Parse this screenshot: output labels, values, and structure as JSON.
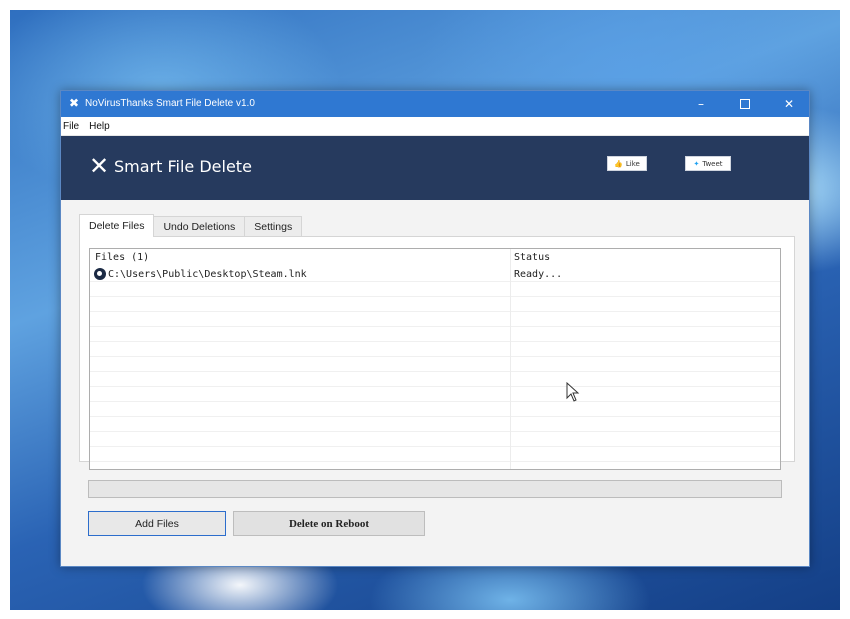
{
  "window": {
    "title": "NoVirusThanks Smart File Delete v1.0",
    "min_glyph": "–",
    "close_glyph": "✕"
  },
  "menu": {
    "items": [
      "File",
      "Help"
    ]
  },
  "banner": {
    "logo_glyph": "✕",
    "title": "Smart File Delete",
    "like_label": "Like",
    "tweet_label": "Tweet"
  },
  "tabs": [
    {
      "label": "Delete Files",
      "active": true
    },
    {
      "label": "Undo Deletions",
      "active": false
    },
    {
      "label": "Settings",
      "active": false
    }
  ],
  "file_list": {
    "columns": {
      "files": "Files (1)",
      "status": "Status"
    },
    "rows": [
      {
        "path": "C:\\Users\\Public\\Desktop\\Steam.lnk",
        "status": "Ready..."
      }
    ]
  },
  "progress": {
    "value": 0
  },
  "buttons": {
    "add_files": "Add Files",
    "delete_on_reboot": "Delete on Reboot"
  },
  "colors": {
    "titlebar": "#2f78d2",
    "banner": "#263a5e"
  },
  "icons": {
    "app": "x-logo-icon",
    "file": "steam-icon",
    "cursor": "mouse-pointer-icon"
  }
}
